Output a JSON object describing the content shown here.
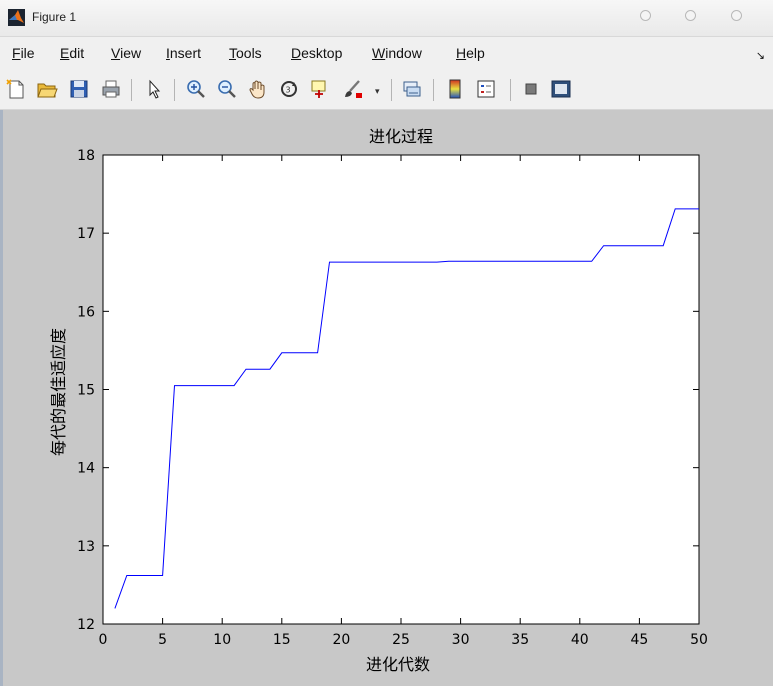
{
  "window": {
    "title": "Figure 1"
  },
  "menubar": {
    "items": [
      {
        "mnemonic": "F",
        "rest": "ile"
      },
      {
        "mnemonic": "E",
        "rest": "dit"
      },
      {
        "mnemonic": "V",
        "rest": "iew"
      },
      {
        "mnemonic": "I",
        "rest": "nsert"
      },
      {
        "mnemonic": "T",
        "rest": "ools"
      },
      {
        "mnemonic": "D",
        "rest": "esktop"
      },
      {
        "mnemonic": "W",
        "rest": "indow"
      },
      {
        "mnemonic": "H",
        "rest": "elp"
      }
    ]
  },
  "toolbar": {
    "buttons": [
      "new-figure-icon",
      "open-file-icon",
      "save-icon",
      "print-icon",
      "select-arrow-icon",
      "zoom-in-icon",
      "zoom-out-icon",
      "pan-hand-icon",
      "rotate-3d-icon",
      "data-cursor-icon",
      "brush-icon",
      "link-plot-icon",
      "colorbar-icon",
      "legend-icon",
      "hide-plot-tools-icon",
      "show-plot-tools-icon"
    ]
  },
  "chart_data": {
    "type": "line",
    "title": "进化过程",
    "xlabel": "进化代数",
    "ylabel": "每代的最佳适应度",
    "xlim": [
      0,
      50
    ],
    "ylim": [
      12,
      18
    ],
    "xticks": [
      0,
      5,
      10,
      15,
      20,
      25,
      30,
      35,
      40,
      45,
      50
    ],
    "yticks": [
      12,
      13,
      14,
      15,
      16,
      17,
      18
    ],
    "grid": false,
    "series": [
      {
        "color": "#0000ff",
        "x": [
          1,
          2,
          3,
          4,
          5,
          6,
          7,
          8,
          9,
          10,
          11,
          12,
          13,
          14,
          15,
          16,
          17,
          18,
          19,
          20,
          21,
          22,
          23,
          24,
          25,
          26,
          27,
          28,
          29,
          30,
          31,
          32,
          33,
          34,
          35,
          36,
          37,
          38,
          39,
          40,
          41,
          42,
          43,
          44,
          45,
          46,
          47,
          48,
          49,
          50
        ],
        "y": [
          12.2,
          12.62,
          12.62,
          12.62,
          12.62,
          15.05,
          15.05,
          15.05,
          15.05,
          15.05,
          15.05,
          15.26,
          15.26,
          15.26,
          15.47,
          15.47,
          15.47,
          15.47,
          16.63,
          16.63,
          16.63,
          16.63,
          16.63,
          16.63,
          16.63,
          16.63,
          16.63,
          16.63,
          16.64,
          16.64,
          16.64,
          16.64,
          16.64,
          16.64,
          16.64,
          16.64,
          16.64,
          16.64,
          16.64,
          16.64,
          16.64,
          16.84,
          16.84,
          16.84,
          16.84,
          16.84,
          16.84,
          17.31,
          17.31,
          17.31
        ]
      }
    ]
  }
}
